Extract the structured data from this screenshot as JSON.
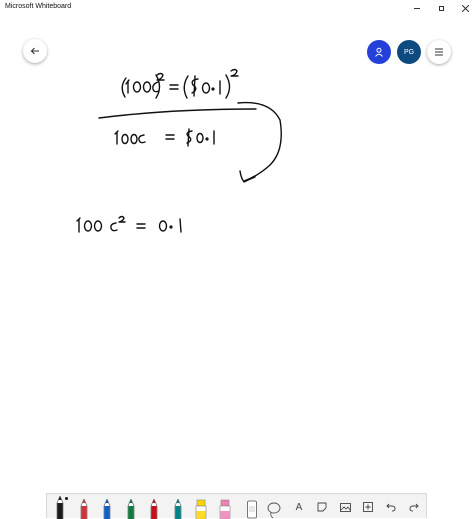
{
  "window": {
    "title": "Microsoft Whiteboard"
  },
  "header": {
    "initials": "PG"
  },
  "pens": [
    {
      "name": "black-pen",
      "color": "#1a1a1a"
    },
    {
      "name": "red-pen",
      "color": "#d13438"
    },
    {
      "name": "blue-pen",
      "color": "#0f5fc7"
    },
    {
      "name": "green-pen",
      "color": "#107c41"
    },
    {
      "name": "red-pen-2",
      "color": "#c50f1f"
    },
    {
      "name": "teal-pen",
      "color": "#038387"
    }
  ],
  "highlighters": [
    {
      "name": "yellow-highlighter",
      "color": "#ffd400"
    },
    {
      "name": "pink-highlighter",
      "color": "#f07fb4"
    }
  ],
  "toolbar": {
    "text_tool": "A"
  }
}
